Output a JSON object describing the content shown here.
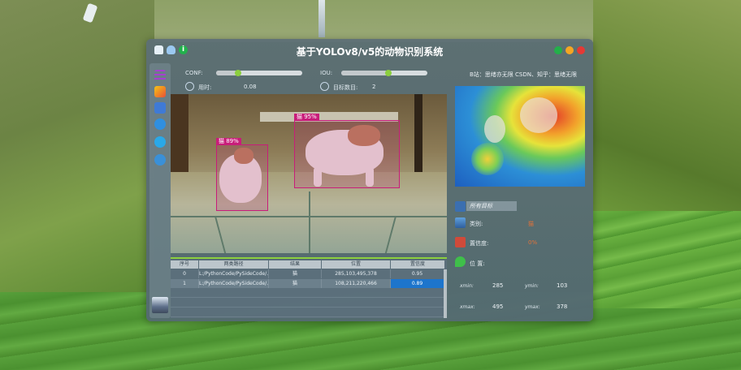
{
  "window": {
    "title": "基于YOLOv8/v5的动物识别系统",
    "info": "B站：思绪亦无限  CSDN、知乎：思绪无限"
  },
  "controls": {
    "conf_label": "CONF:",
    "conf_value": 0.25,
    "iou_label": "IOU:",
    "iou_value": 0.55
  },
  "stats": {
    "time_label": "用时:",
    "time_value": "0.08",
    "count_label": "目标数目:",
    "count_value": "2"
  },
  "detections": [
    {
      "label": "猫  89%"
    },
    {
      "label": "猫  95%"
    }
  ],
  "table": {
    "headers": [
      "序号",
      "两类路径",
      "结果",
      "位置",
      "置信度"
    ],
    "rows": [
      {
        "index": "0",
        "path": "L:/PythonCode/PySideCode/...",
        "result": "猫",
        "position": "285,103,495,378",
        "confidence": "0.95"
      },
      {
        "index": "1",
        "path": "L:/PythonCode/PySideCode/...",
        "result": "猫",
        "position": "108,211,220,466",
        "confidence": "0.89"
      }
    ]
  },
  "details": {
    "target_select": "所有目标",
    "type_label": "类别:",
    "type_value": "猫",
    "confidence_label": "置信度:",
    "confidence_value": "0%",
    "position_label": "位 置:",
    "xmin_label": "xmin:",
    "xmin_value": "285",
    "ymin_label": "ymin:",
    "ymin_value": "103",
    "xmax_label": "xmax:",
    "xmax_value": "495",
    "ymax_label": "ymax:",
    "ymax_value": "378"
  },
  "colors": {
    "detection_box": "#c81d7a",
    "accent_green": "#8ccf3e",
    "selected_row": "#1d75cc",
    "value_orange": "#e0723a"
  }
}
